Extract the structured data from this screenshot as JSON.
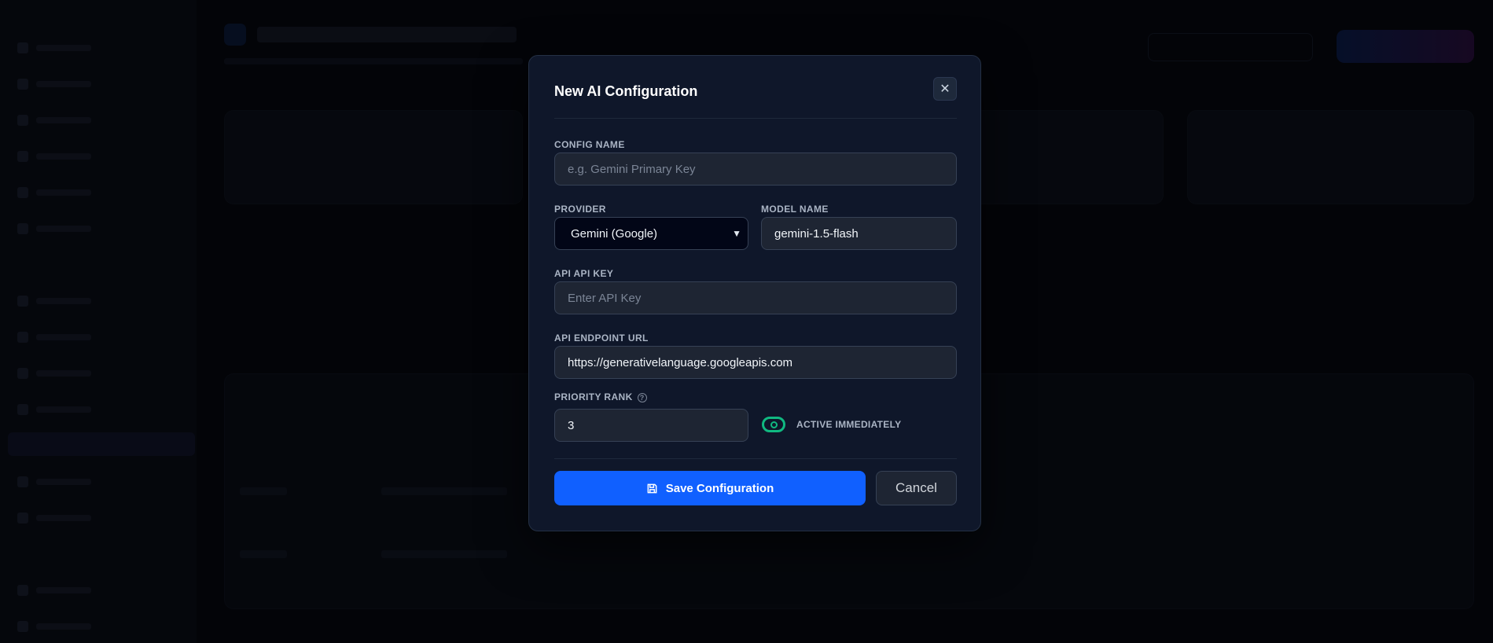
{
  "modal": {
    "title": "New AI Configuration",
    "close_icon": "close-icon",
    "config_name": {
      "label": "CONFIG NAME",
      "value": "",
      "placeholder": "e.g. Gemini Primary Key"
    },
    "provider": {
      "label": "PROVIDER",
      "selected": "Gemini (Google)"
    },
    "model_name": {
      "label": "MODEL NAME",
      "value": "gemini-1.5-flash"
    },
    "api_key": {
      "label": "API API KEY",
      "value": "",
      "placeholder": "Enter API Key"
    },
    "endpoint": {
      "label": "API ENDPOINT URL",
      "value": "https://generativelanguage.googleapis.com"
    },
    "priority": {
      "label": "PRIORITY RANK",
      "value": "3"
    },
    "active": {
      "label": "ACTIVE IMMEDIATELY",
      "on": true
    },
    "save_label": "Save Configuration",
    "cancel_label": "Cancel"
  },
  "colors": {
    "accent": "#1060ff",
    "toggle_on": "#10b981",
    "modal_bg": "#0f172a"
  }
}
